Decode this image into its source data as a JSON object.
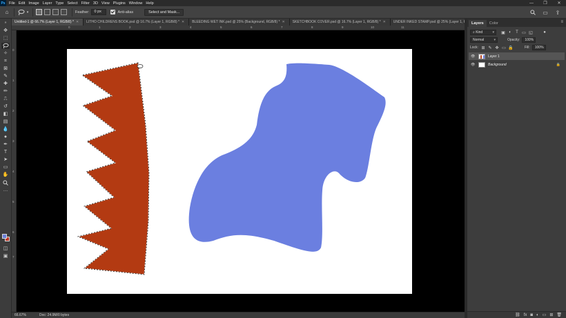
{
  "app": {
    "logo": "Ps"
  },
  "menu": [
    "File",
    "Edit",
    "Image",
    "Layer",
    "Type",
    "Select",
    "Filter",
    "3D",
    "View",
    "Plugins",
    "Window",
    "Help"
  ],
  "window_controls": [
    "—",
    "❐",
    "✕"
  ],
  "options_bar": {
    "home_icon": "home-icon",
    "tool_icon": "lasso-icon",
    "feather_label": "Feather:",
    "feather_value": "0 px",
    "antialias_label": "Anti-alias",
    "select_mask_button": "Select and Mask...",
    "right_icons": [
      "search-icon",
      "workspace-icon",
      "share-icon"
    ]
  },
  "tabs": [
    {
      "label": "Untitled-1 @ 66.7% (Layer 1, RGB/8) *",
      "active": true
    },
    {
      "label": "LITHO CHILDRENS BOOK.psd @ 16.7% (Layer 1, RGB/8) *",
      "active": false
    },
    {
      "label": "BLEEDING WET INK.psd @ 25% (Background, RGB/8) *",
      "active": false
    },
    {
      "label": "SKETCHBOOK COVER.psd @ 16.7% (Layer 1, RGB/8) *",
      "active": false
    },
    {
      "label": "UNDER INKED STAMP.psd @ 25% (Layer 1, RGB/8) *",
      "active": false
    }
  ],
  "ruler": {
    "h_labels": [
      "0",
      "1",
      "2",
      "3",
      "4",
      "5",
      "6",
      "7",
      "8",
      "9",
      "10",
      "11"
    ],
    "v_labels": [
      "0",
      "1",
      "2",
      "3",
      "4",
      "5",
      "6",
      "7"
    ]
  },
  "colors": {
    "shape_red": "#b33a12",
    "shape_blue": "#6b7fe0",
    "foreground": "#6a7ed8",
    "background": "#c0392b"
  },
  "status": {
    "zoom": "66.67%",
    "doc": "Doc: 24.9M/0 bytes"
  },
  "panels": {
    "tabs": [
      "Layers",
      "Color"
    ],
    "kind_label": "Kind",
    "blend_mode": "Normal",
    "opacity_label": "Opacity:",
    "opacity_value": "100%",
    "lock_label": "Lock:",
    "fill_label": "Fill:",
    "fill_value": "100%",
    "layers": [
      {
        "name": "Layer 1",
        "selected": true,
        "locked": false
      },
      {
        "name": "Background",
        "selected": false,
        "locked": true
      }
    ],
    "footer_icons": [
      "link-icon",
      "fx-icon",
      "mask-icon",
      "adjustment-icon",
      "group-icon",
      "new-layer-icon",
      "trash-icon"
    ]
  }
}
